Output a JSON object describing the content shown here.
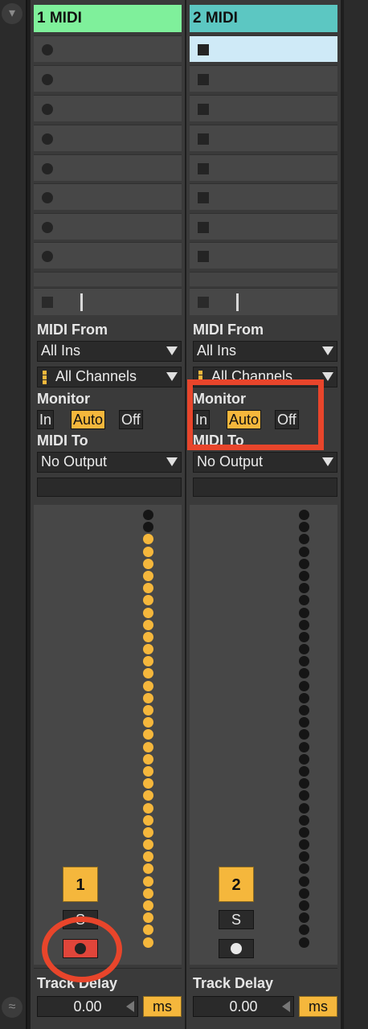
{
  "colors": {
    "track1_header": "#7ff09b",
    "track2_header": "#5cc7c2",
    "accent": "#f5b73c",
    "arm_active": "#e0453a",
    "annotation": "#e8452b",
    "selected_slot": "#cfeaf7"
  },
  "tracks": [
    {
      "name": "1 MIDI",
      "midi_from_label": "MIDI From",
      "input": "All Ins",
      "channel": "All Channels",
      "monitor_label": "Monitor",
      "monitor": [
        "In",
        "Auto",
        "Off"
      ],
      "monitor_active": "Auto",
      "midi_to_label": "MIDI To",
      "output": "No Output",
      "number": "1",
      "solo_label": "S",
      "arm_on": true,
      "delay_label": "Track Delay",
      "delay_value": "0.00",
      "delay_unit": "ms"
    },
    {
      "name": "2 MIDI",
      "midi_from_label": "MIDI From",
      "input": "All Ins",
      "channel": "All Channels",
      "monitor_label": "Monitor",
      "monitor": [
        "In",
        "Auto",
        "Off"
      ],
      "monitor_active": "Auto",
      "midi_to_label": "MIDI To",
      "output": "No Output",
      "number": "2",
      "solo_label": "S",
      "arm_on": false,
      "delay_label": "Track Delay",
      "delay_value": "0.00",
      "delay_unit": "ms"
    }
  ],
  "icons": {
    "left_rail_top": "chevron-down-icon",
    "left_rail_bottom": "wave-icon"
  }
}
